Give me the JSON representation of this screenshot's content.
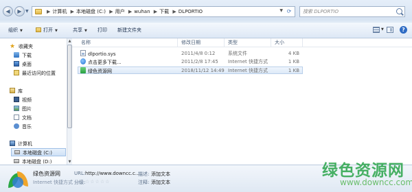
{
  "window_controls": {
    "minimize": "–",
    "maximize": "□",
    "close": "✕"
  },
  "address_bar": {
    "breadcrumbs": [
      "计算机",
      "本地磁盘 (C:)",
      "用户",
      "wuhan",
      "下载",
      "DLPORTIO"
    ],
    "separator": "▶"
  },
  "search": {
    "placeholder": "搜索 DLPORTIO"
  },
  "toolbar": {
    "organize": "组织",
    "open": "打开",
    "share": "共享",
    "print": "打印",
    "new_folder": "新建文件夹"
  },
  "nav": {
    "favorites": "收藏夹",
    "downloads": "下载",
    "desktop": "桌面",
    "recent": "最近访问的位置",
    "libraries": "库",
    "videos": "视频",
    "pictures": "图片",
    "documents": "文档",
    "music": "音乐",
    "computer": "计算机",
    "drive_c": "本地磁盘 (C:)",
    "drive_d": "本地磁盘 (D:)"
  },
  "columns": {
    "name": "名称",
    "modified": "修改日期",
    "type": "类型",
    "size": "大小"
  },
  "files": [
    {
      "name": "dlportio.sys",
      "modified": "2011/4/8 0:12",
      "type": "系统文件",
      "size": "4 KB",
      "icon": "system-file-icon"
    },
    {
      "name": "点击更多下载...",
      "modified": "2011/2/8 17:45",
      "type": "Internet 快捷方式",
      "size": "1 KB",
      "icon": "internet-shortcut-icon"
    },
    {
      "name": "绿色资源网",
      "modified": "2018/11/12 14:49",
      "type": "Internet 快捷方式",
      "size": "1 KB",
      "icon": "green-shortcut-icon"
    }
  ],
  "details": {
    "name": "绿色资源网",
    "type": "Internet 快捷方式",
    "url_label": "URL:",
    "url_value": "http://www.downcc.c...",
    "desc_label": "描述:",
    "desc_value": "添加文本",
    "rating_label": "分级:",
    "rating_value": "☆☆☆☆☆",
    "tag_label": "注释:",
    "tag_value": "添加文本"
  },
  "watermark": {
    "cn": "绿色资源网",
    "url": "www.downcc.com"
  }
}
